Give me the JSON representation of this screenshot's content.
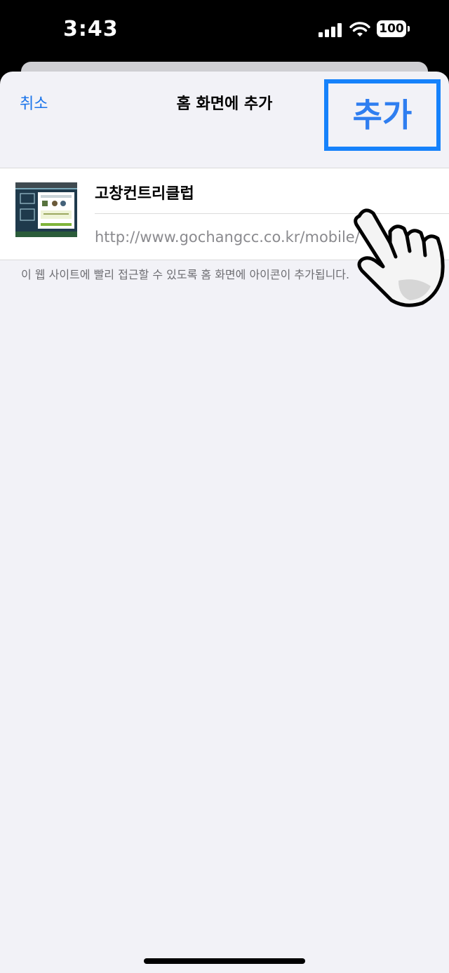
{
  "status_bar": {
    "time": "3:43",
    "battery": "100"
  },
  "header": {
    "cancel": "취소",
    "title": "홈 화면에 추가",
    "add": "추가"
  },
  "bookmark": {
    "name": "고창컨트리클럽",
    "url": "http://www.gochangcc.co.kr/mobile/"
  },
  "hint": "이 웹 사이트에 빨리 접근할 수 있도록 홈 화면에 아이콘이 추가됩니다.",
  "colors": {
    "accent": "#1a74ea",
    "highlight": "#1682fb",
    "add_text": "#2f7ef0",
    "background": "#f2f2f7"
  },
  "icons": [
    "cellular-signal-icon",
    "wifi-icon",
    "battery-icon",
    "pointing-hand-icon"
  ]
}
